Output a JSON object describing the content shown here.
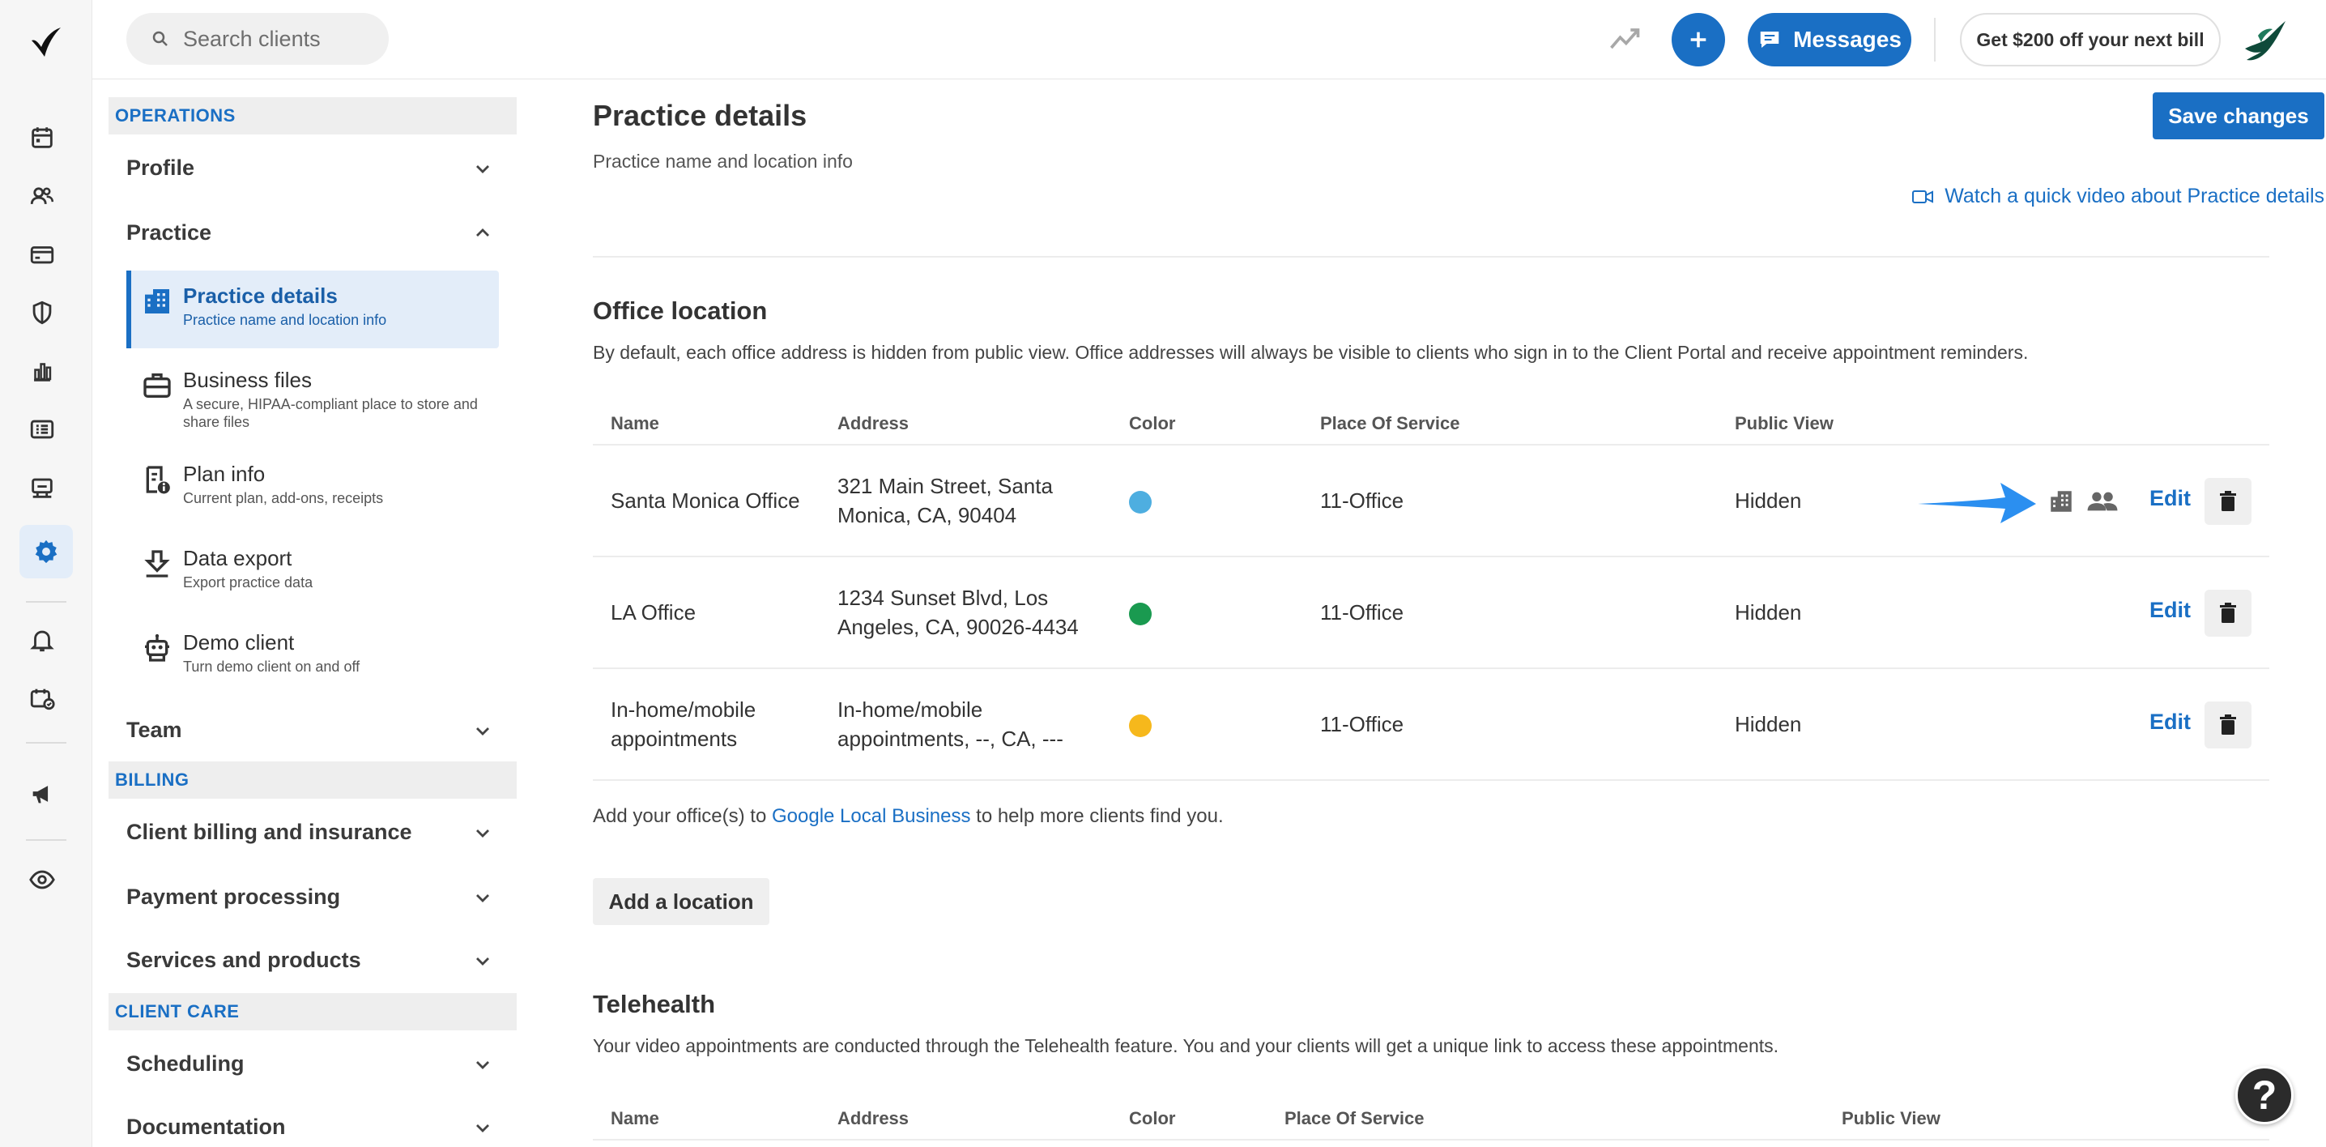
{
  "app": {
    "brand_color": "#1a6fc4"
  },
  "rail": {
    "icons": [
      "calendar-icon",
      "clients-icon",
      "billing-card-icon",
      "insurance-shield-icon",
      "analytics-icon",
      "activity-list-icon",
      "reports-icon",
      "settings-gear-icon",
      "notifications-bell-icon",
      "requests-icon",
      "marketing-megaphone-icon",
      "visibility-eye-icon"
    ],
    "active": "settings-gear-icon"
  },
  "topbar": {
    "search_placeholder": "Search clients",
    "messages_label": "Messages",
    "promo_label": "Get $200 off your next bill"
  },
  "nav": {
    "operations_label": "OPERATIONS",
    "profile_label": "Profile",
    "practice_label": "Practice",
    "practice_items": [
      {
        "title": "Practice details",
        "desc": "Practice name and location info",
        "icon": "building-icon"
      },
      {
        "title": "Business files",
        "desc": "A secure, HIPAA-compliant place to store and share files",
        "icon": "briefcase-icon"
      },
      {
        "title": "Plan info",
        "desc": "Current plan, add-ons, receipts",
        "icon": "receipt-info-icon"
      },
      {
        "title": "Data export",
        "desc": "Export practice data",
        "icon": "export-icon"
      },
      {
        "title": "Demo client",
        "desc": "Turn demo client on and off",
        "icon": "robot-icon"
      }
    ],
    "team_label": "Team",
    "billing_label": "BILLING",
    "client_billing_label": "Client billing and insurance",
    "payment_label": "Payment processing",
    "services_label": "Services and products",
    "client_care_label": "CLIENT CARE",
    "scheduling_label": "Scheduling",
    "documentation_label": "Documentation"
  },
  "main": {
    "title": "Practice details",
    "subtitle": "Practice name and location info",
    "save_label": "Save changes",
    "video_link": "Watch a quick video about Practice details",
    "office": {
      "title": "Office location",
      "desc": "By default, each office address is hidden from public view. Office addresses will always be visible to clients who sign in to the Client Portal and receive appointment reminders.",
      "headers": [
        "Name",
        "Address",
        "Color",
        "Place Of Service",
        "Public View"
      ],
      "rows": [
        {
          "name": "Santa Monica Office",
          "address": "321 Main Street, Santa Monica, CA, 90404",
          "color": "#4eaee0",
          "pos": "11-Office",
          "public": "Hidden",
          "edit": "Edit"
        },
        {
          "name": "LA Office",
          "address": "1234 Sunset Blvd, Los Angeles, CA, 90026-4434",
          "color": "#1a9a50",
          "pos": "11-Office",
          "public": "Hidden",
          "edit": "Edit"
        },
        {
          "name": "In-home/mobile appointments",
          "address": "In-home/mobile appointments, --, CA, ---",
          "color": "#f6b81c",
          "pos": "11-Office",
          "public": "Hidden",
          "edit": "Edit"
        }
      ],
      "google_prefix": "Add your office(s) to ",
      "google_link": "Google Local Business",
      "google_suffix": " to help more clients find you.",
      "add_label": "Add a location"
    },
    "telehealth": {
      "title": "Telehealth",
      "desc": "Your video appointments are conducted through the Telehealth feature. You and your clients will get a unique link to access these appointments.",
      "headers": [
        "Name",
        "Address",
        "Color",
        "Place Of Service",
        "Public View"
      ]
    }
  },
  "help_label": "?"
}
